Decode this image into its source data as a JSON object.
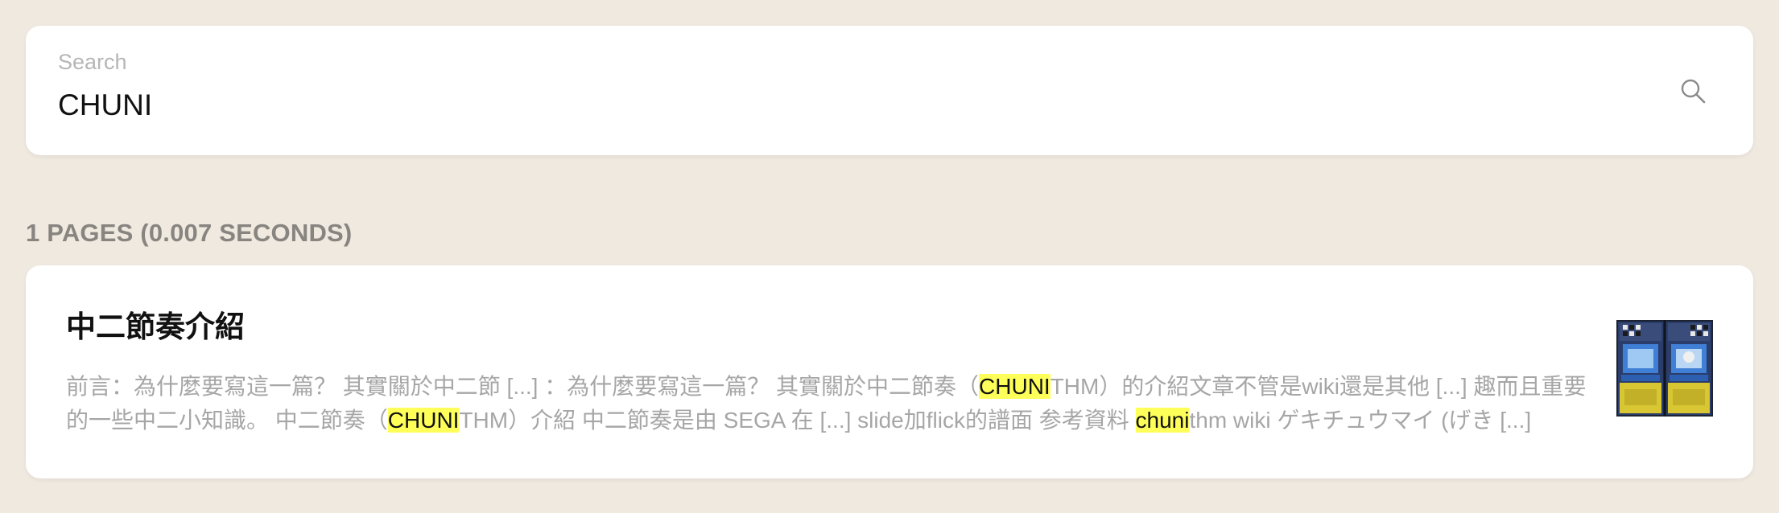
{
  "search": {
    "label": "Search",
    "value": "CHUNI"
  },
  "results_summary": "1 PAGES (0.007 SECONDS)",
  "results": [
    {
      "title": "中二節奏介紹",
      "snippet": [
        {
          "text": "前言：為什麼要寫這一篇？ 其實關於中二節 [...] ：為什麼要寫這一篇？ 其實關於中二節奏（",
          "hl": false
        },
        {
          "text": "CHUNI",
          "hl": true
        },
        {
          "text": "THM）的介紹文章不管是wiki還是其他 [...] 趣而且重要的一些中二小知識。 中二節奏（",
          "hl": false
        },
        {
          "text": "CHUNI",
          "hl": true
        },
        {
          "text": "THM）介紹 中二節奏是由 SEGA 在 [...] slide加flick的譜面 参考資料 ",
          "hl": false
        },
        {
          "text": "chuni",
          "hl": true
        },
        {
          "text": "thm wiki ゲキチュウマイ (げき [...]",
          "hl": false
        }
      ],
      "thumbnail_icon": "arcade-cabinet-thumbnail"
    }
  ],
  "colors": {
    "background": "#efe9df",
    "card": "#ffffff",
    "highlight": "#ffff5a",
    "muted_text": "#a6a6a6"
  }
}
